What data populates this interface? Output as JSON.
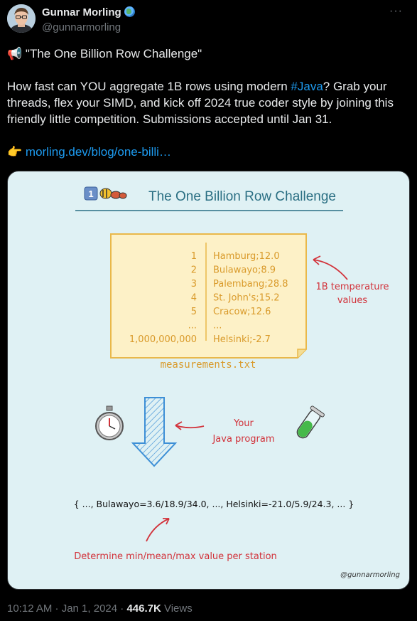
{
  "author": {
    "name": "Gunnar Morling",
    "handle": "@gunnarmorling",
    "badge_icon": "globe-icon"
  },
  "tweet": {
    "title_line": "\"The One Billion Row Challenge\"",
    "body_pre": "How fast can YOU aggregate 1B rows using modern ",
    "hashtag": "#Java",
    "body_post": "? Grab your threads, flex your SIMD, and kick off 2024 true coder style by joining this friendly little competition. Submissions accepted until Jan 31.",
    "link_text": "morling.dev/blog/one-billi…",
    "megaphone_icon": "megaphone-icon",
    "pointing_icon": "pointing-hand-icon"
  },
  "image": {
    "title": "The One Billion Row Challenge",
    "rows": [
      {
        "num": "1",
        "value": "Hamburg;12.0"
      },
      {
        "num": "2",
        "value": "Bulawayo;8.9"
      },
      {
        "num": "3",
        "value": "Palembang;28.8"
      },
      {
        "num": "4",
        "value": "St. John's;15.2"
      },
      {
        "num": "5",
        "value": "Cracow;12.6"
      },
      {
        "num": "...",
        "value": "..."
      },
      {
        "num": "1,000,000,000",
        "value": "Helsinki;-2.7"
      }
    ],
    "file_label": "measurements.txt",
    "annotation_values_1": "1B temperature",
    "annotation_values_2": "values",
    "annotation_program_1": "Your",
    "annotation_program_2": "Java program",
    "result_line": "{ ..., Bulawayo=3.6/18.9/34.0, ..., Helsinki=-21.0/5.9/24.3, ... }",
    "determine_text": "Determine min/mean/max value per station",
    "signature": "@gunnarmorling",
    "colors": {
      "background": "#dff1f4",
      "note": "#fdf1c7",
      "note_border": "#e9b84a",
      "ink_red": "#d2323a",
      "arrow_blue": "#3d8fd6",
      "title_teal": "#2a6f83"
    }
  },
  "meta": {
    "time": "10:12 AM · Jan 1, 2024 · ",
    "views_count": "446.7K",
    "views_label": " Views"
  }
}
